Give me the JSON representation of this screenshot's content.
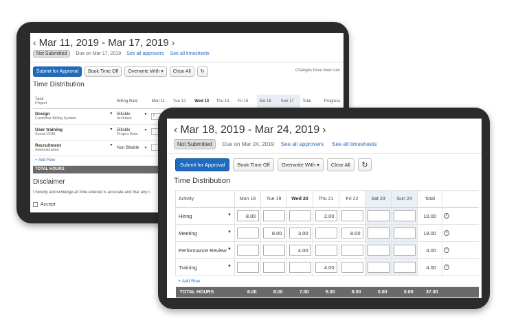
{
  "back": {
    "title": "Mar 11, 2019 - Mar 17, 2019",
    "status": "Not Submitted",
    "due": "Due on Mar 17, 2019",
    "see_all_approvers": "See all approvers",
    "see_all_timesheets": "See all timesheets",
    "toolbar": {
      "submit": "Submit for Approval",
      "book_time_off": "Book Time Off",
      "overwrite_with": "Overwrite With",
      "clear_all": "Clear All"
    },
    "notice": "Changes have been sav",
    "section_title": "Time Distribution",
    "headers": {
      "task": "Task",
      "project": "Project",
      "billing_rate": "Billing Rate",
      "days": [
        "Mon 11",
        "Tue 12",
        "Wed 13",
        "Thu 14",
        "Fri 15",
        "Sat 16",
        "Sun 17"
      ],
      "total": "Total",
      "progress": "Progress"
    },
    "rows": [
      {
        "task": "Design",
        "project": "Customer Billing System",
        "rate": "Billable",
        "rate_sub": "Architect",
        "mon": "7"
      },
      {
        "task": "User training",
        "project": "Social CRM",
        "rate": "Billable",
        "rate_sub": "Project Rate",
        "mon": ""
      },
      {
        "task": "Recruitment",
        "project": "Administration",
        "rate": "Non Billable",
        "rate_sub": "",
        "mon": ""
      }
    ],
    "add_row": "+ Add Row",
    "total_label": "TOTAL HOURS",
    "disclaimer_title": "Disclaimer",
    "disclaimer_text": "I hereby acknowledge all time entered is accurate and that any c",
    "accept": "Accept"
  },
  "front": {
    "title": "Mar 18, 2019 - Mar 24, 2019",
    "status": "Not Submitted",
    "due": "Due on Mar 24, 2019",
    "see_all_approvers": "See all approvers",
    "see_all_timesheets": "See all timesheets",
    "toolbar": {
      "submit": "Submit for Approval",
      "book_time_off": "Book Time Off",
      "overwrite_with": "Overwrite With",
      "clear_all": "Clear All"
    },
    "section_title": "Time Distribution",
    "headers": {
      "activity": "Activity",
      "days": [
        "Mon 18",
        "Tue 19",
        "Wed 20",
        "Thu 21",
        "Fri 22",
        "Sat 23",
        "Sun 24"
      ],
      "total": "Total"
    },
    "rows": [
      {
        "activity": "Hiring",
        "values": [
          "8.00",
          "",
          "",
          "2.00",
          "",
          "",
          ""
        ],
        "total": "10.00"
      },
      {
        "activity": "Meeting",
        "values": [
          "",
          "8.00",
          "3.00",
          "",
          "8.00",
          "",
          ""
        ],
        "total": "19.00"
      },
      {
        "activity": "Performance Review",
        "values": [
          "",
          "",
          "4.00",
          "",
          "",
          "",
          ""
        ],
        "total": "4.00"
      },
      {
        "activity": "Training",
        "values": [
          "",
          "",
          "",
          "4.00",
          "",
          "",
          ""
        ],
        "total": "4.00"
      }
    ],
    "add_row": "+ Add Row",
    "total_label": "TOTAL HOURS",
    "day_totals": [
      "8.00",
      "8.00",
      "7.00",
      "6.00",
      "8.00",
      "0.00",
      "0.00"
    ],
    "grand_total": "37.00"
  }
}
